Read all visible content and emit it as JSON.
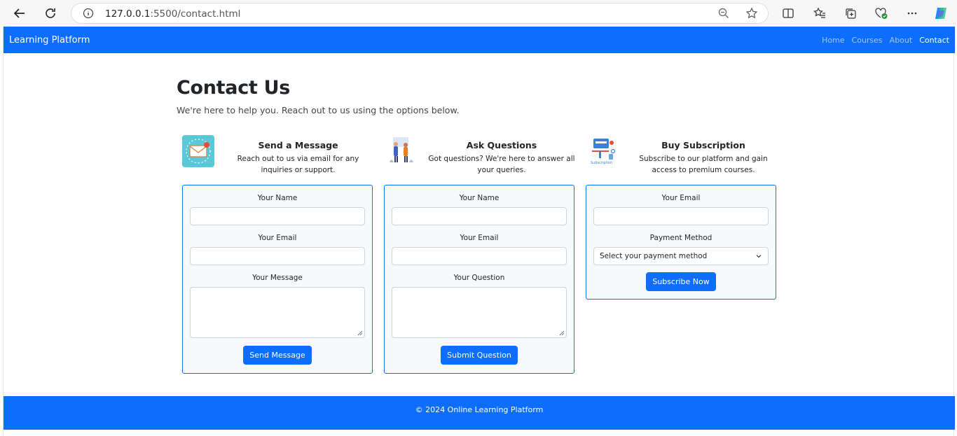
{
  "browser": {
    "url_host": "127.0.0.1",
    "url_path": ":5500/contact.html"
  },
  "navbar": {
    "brand": "Learning Platform",
    "links": [
      {
        "label": "Home"
      },
      {
        "label": "Courses"
      },
      {
        "label": "About"
      },
      {
        "label": "Contact"
      }
    ]
  },
  "header": {
    "title": "Contact Us",
    "subtitle": "We're here to help you. Reach out to us using the options below."
  },
  "sections": [
    {
      "title": "Send a Message",
      "description": "Reach out to us via email for any inquiries or support.",
      "icon": "envelope-icon",
      "fields": [
        "Your Name",
        "Your Email",
        "Your Message"
      ],
      "button": "Send Message"
    },
    {
      "title": "Ask Questions",
      "description": "Got questions? We're here to answer all your queries.",
      "icon": "people-question-icon",
      "fields": [
        "Your Name",
        "Your Email",
        "Your Question"
      ],
      "button": "Submit Question"
    },
    {
      "title": "Buy Subscription",
      "description": "Subscribe to our platform and gain access to premium courses.",
      "icon": "subscription-icon",
      "fields": [
        "Your Email",
        "Payment Method"
      ],
      "select_placeholder": "Select your payment method",
      "button": "Subscribe Now"
    }
  ],
  "footer": {
    "text": "© 2024 Online Learning Platform"
  },
  "colors": {
    "primary": "#0d6efd",
    "card_bg": "#f8f9fa"
  }
}
